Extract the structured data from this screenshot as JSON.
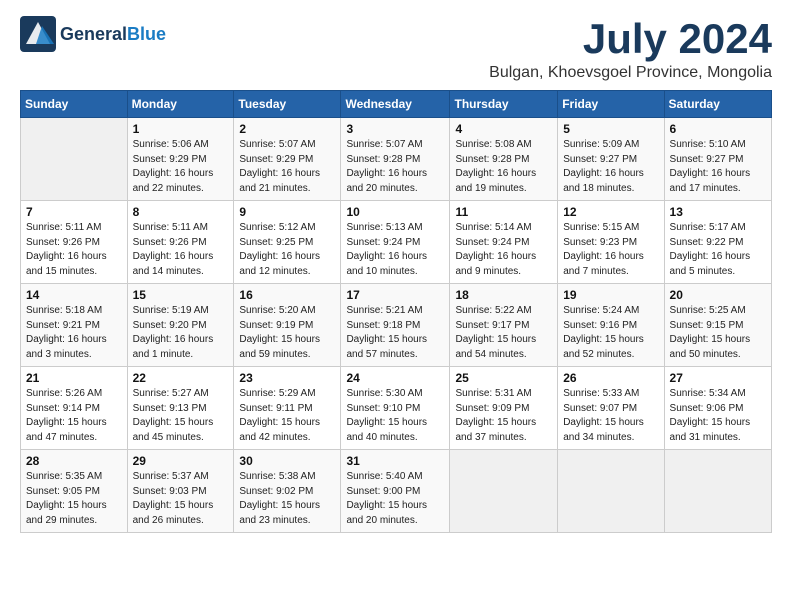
{
  "header": {
    "logo_general": "General",
    "logo_blue": "Blue",
    "month": "July 2024",
    "location": "Bulgan, Khoevsgoel Province, Mongolia"
  },
  "weekdays": [
    "Sunday",
    "Monday",
    "Tuesday",
    "Wednesday",
    "Thursday",
    "Friday",
    "Saturday"
  ],
  "weeks": [
    [
      {
        "day": "",
        "info": ""
      },
      {
        "day": "1",
        "info": "Sunrise: 5:06 AM\nSunset: 9:29 PM\nDaylight: 16 hours\nand 22 minutes."
      },
      {
        "day": "2",
        "info": "Sunrise: 5:07 AM\nSunset: 9:29 PM\nDaylight: 16 hours\nand 21 minutes."
      },
      {
        "day": "3",
        "info": "Sunrise: 5:07 AM\nSunset: 9:28 PM\nDaylight: 16 hours\nand 20 minutes."
      },
      {
        "day": "4",
        "info": "Sunrise: 5:08 AM\nSunset: 9:28 PM\nDaylight: 16 hours\nand 19 minutes."
      },
      {
        "day": "5",
        "info": "Sunrise: 5:09 AM\nSunset: 9:27 PM\nDaylight: 16 hours\nand 18 minutes."
      },
      {
        "day": "6",
        "info": "Sunrise: 5:10 AM\nSunset: 9:27 PM\nDaylight: 16 hours\nand 17 minutes."
      }
    ],
    [
      {
        "day": "7",
        "info": "Sunrise: 5:11 AM\nSunset: 9:26 PM\nDaylight: 16 hours\nand 15 minutes."
      },
      {
        "day": "8",
        "info": "Sunrise: 5:11 AM\nSunset: 9:26 PM\nDaylight: 16 hours\nand 14 minutes."
      },
      {
        "day": "9",
        "info": "Sunrise: 5:12 AM\nSunset: 9:25 PM\nDaylight: 16 hours\nand 12 minutes."
      },
      {
        "day": "10",
        "info": "Sunrise: 5:13 AM\nSunset: 9:24 PM\nDaylight: 16 hours\nand 10 minutes."
      },
      {
        "day": "11",
        "info": "Sunrise: 5:14 AM\nSunset: 9:24 PM\nDaylight: 16 hours\nand 9 minutes."
      },
      {
        "day": "12",
        "info": "Sunrise: 5:15 AM\nSunset: 9:23 PM\nDaylight: 16 hours\nand 7 minutes."
      },
      {
        "day": "13",
        "info": "Sunrise: 5:17 AM\nSunset: 9:22 PM\nDaylight: 16 hours\nand 5 minutes."
      }
    ],
    [
      {
        "day": "14",
        "info": "Sunrise: 5:18 AM\nSunset: 9:21 PM\nDaylight: 16 hours\nand 3 minutes."
      },
      {
        "day": "15",
        "info": "Sunrise: 5:19 AM\nSunset: 9:20 PM\nDaylight: 16 hours\nand 1 minute."
      },
      {
        "day": "16",
        "info": "Sunrise: 5:20 AM\nSunset: 9:19 PM\nDaylight: 15 hours\nand 59 minutes."
      },
      {
        "day": "17",
        "info": "Sunrise: 5:21 AM\nSunset: 9:18 PM\nDaylight: 15 hours\nand 57 minutes."
      },
      {
        "day": "18",
        "info": "Sunrise: 5:22 AM\nSunset: 9:17 PM\nDaylight: 15 hours\nand 54 minutes."
      },
      {
        "day": "19",
        "info": "Sunrise: 5:24 AM\nSunset: 9:16 PM\nDaylight: 15 hours\nand 52 minutes."
      },
      {
        "day": "20",
        "info": "Sunrise: 5:25 AM\nSunset: 9:15 PM\nDaylight: 15 hours\nand 50 minutes."
      }
    ],
    [
      {
        "day": "21",
        "info": "Sunrise: 5:26 AM\nSunset: 9:14 PM\nDaylight: 15 hours\nand 47 minutes."
      },
      {
        "day": "22",
        "info": "Sunrise: 5:27 AM\nSunset: 9:13 PM\nDaylight: 15 hours\nand 45 minutes."
      },
      {
        "day": "23",
        "info": "Sunrise: 5:29 AM\nSunset: 9:11 PM\nDaylight: 15 hours\nand 42 minutes."
      },
      {
        "day": "24",
        "info": "Sunrise: 5:30 AM\nSunset: 9:10 PM\nDaylight: 15 hours\nand 40 minutes."
      },
      {
        "day": "25",
        "info": "Sunrise: 5:31 AM\nSunset: 9:09 PM\nDaylight: 15 hours\nand 37 minutes."
      },
      {
        "day": "26",
        "info": "Sunrise: 5:33 AM\nSunset: 9:07 PM\nDaylight: 15 hours\nand 34 minutes."
      },
      {
        "day": "27",
        "info": "Sunrise: 5:34 AM\nSunset: 9:06 PM\nDaylight: 15 hours\nand 31 minutes."
      }
    ],
    [
      {
        "day": "28",
        "info": "Sunrise: 5:35 AM\nSunset: 9:05 PM\nDaylight: 15 hours\nand 29 minutes."
      },
      {
        "day": "29",
        "info": "Sunrise: 5:37 AM\nSunset: 9:03 PM\nDaylight: 15 hours\nand 26 minutes."
      },
      {
        "day": "30",
        "info": "Sunrise: 5:38 AM\nSunset: 9:02 PM\nDaylight: 15 hours\nand 23 minutes."
      },
      {
        "day": "31",
        "info": "Sunrise: 5:40 AM\nSunset: 9:00 PM\nDaylight: 15 hours\nand 20 minutes."
      },
      {
        "day": "",
        "info": ""
      },
      {
        "day": "",
        "info": ""
      },
      {
        "day": "",
        "info": ""
      }
    ]
  ]
}
